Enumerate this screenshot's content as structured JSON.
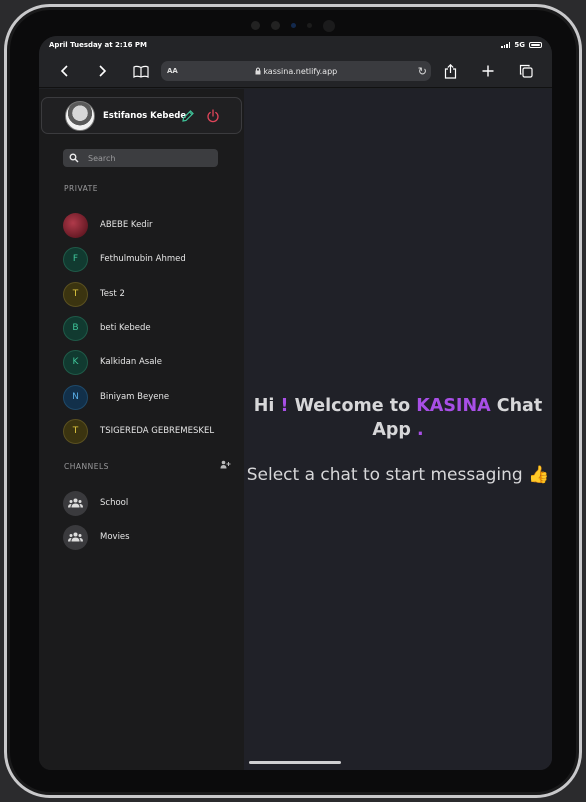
{
  "status": {
    "datetime": "April Tuesday at 2:16 PM",
    "network": "5G"
  },
  "browser": {
    "aa": "AA",
    "url": "kassina.netlify.app"
  },
  "profile": {
    "name": "Estifanos Kebede"
  },
  "search": {
    "placeholder": "Search"
  },
  "sections": {
    "private": "PRIVATE",
    "channels": "CHANNELS"
  },
  "private_chats": [
    {
      "name": "ABEBE Kedir",
      "initial": "",
      "avatar_color": "#7a1c28",
      "text_color": "#ffffff",
      "photo": true
    },
    {
      "name": "Fethulmubin Ahmed",
      "initial": "F",
      "avatar_color": "#113a30",
      "text_color": "#3fc59a",
      "photo": false
    },
    {
      "name": "Test 2",
      "initial": "T",
      "avatar_color": "#3b3410",
      "text_color": "#e0c840",
      "photo": false
    },
    {
      "name": "beti Kebede",
      "initial": "B",
      "avatar_color": "#113a30",
      "text_color": "#3fc59a",
      "photo": false
    },
    {
      "name": "Kalkidan Asale",
      "initial": "K",
      "avatar_color": "#113a30",
      "text_color": "#3fc59a",
      "photo": false
    },
    {
      "name": "Biniyam Beyene",
      "initial": "N",
      "avatar_color": "#12304a",
      "text_color": "#5aaee6",
      "photo": false
    },
    {
      "name": "TSIGEREDA GEBREMESKEL",
      "initial": "T",
      "avatar_color": "#3b3410",
      "text_color": "#e0c840",
      "photo": false
    }
  ],
  "channels": [
    {
      "name": "School",
      "icon": "group-icon"
    },
    {
      "name": "Movies",
      "icon": "group-icon"
    }
  ],
  "main": {
    "hi": "Hi",
    "bang": "!",
    "welcome_to": "Welcome to",
    "brand": "KASINA",
    "chat": "Chat",
    "app": "App",
    "dot": ".",
    "subtitle": "Select a chat to start messaging",
    "emoji": "👍"
  },
  "colors": {
    "accent": "#a84fe6",
    "edit": "#3fc59a",
    "power": "#e0455a"
  }
}
